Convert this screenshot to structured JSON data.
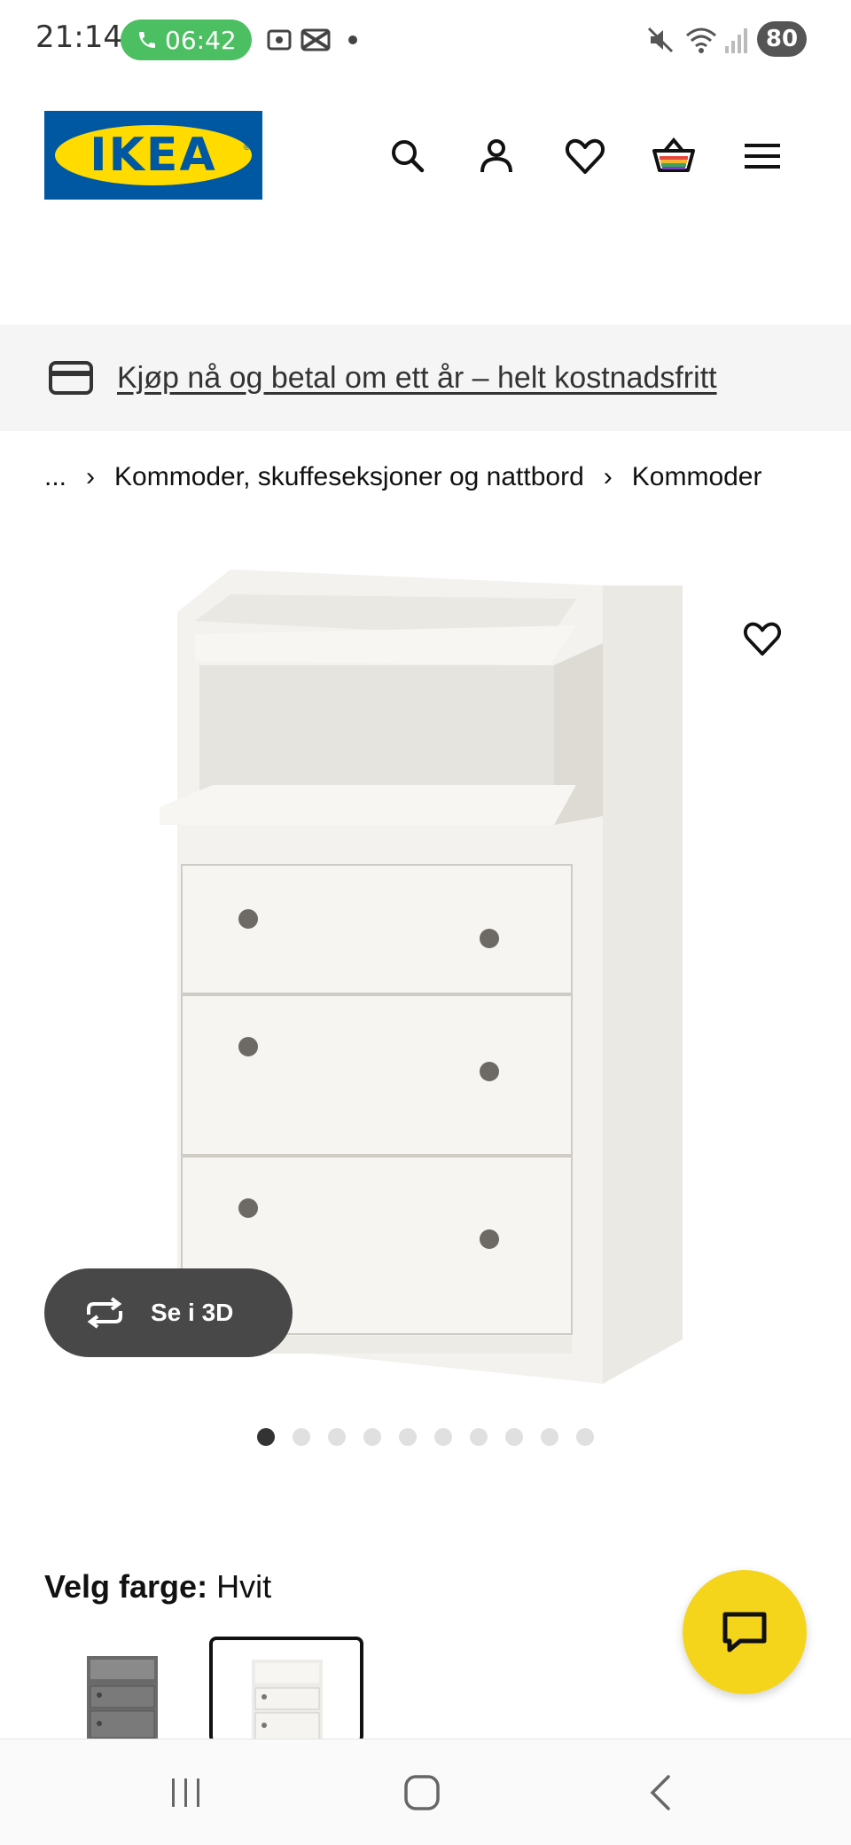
{
  "status_bar": {
    "time": "21:14",
    "call_timer": "06:42",
    "battery": "80"
  },
  "header": {
    "logo_text": "IKEA",
    "icons": [
      "search-icon",
      "account-icon",
      "wishlist-icon",
      "cart-icon",
      "menu-icon"
    ]
  },
  "promo": {
    "text": "Kjøp nå og betal om ett år – helt kostnadsfritt",
    "icon": "credit-card-icon"
  },
  "breadcrumb": {
    "ellipsis": "...",
    "items": [
      "Kommoder, skuffeseksjoner og nattbord",
      "Kommoder"
    ]
  },
  "product": {
    "view_3d_label": "Se i 3D",
    "carousel": {
      "total": 10,
      "active": 1
    }
  },
  "color": {
    "label": "Velg farge:",
    "value": "Hvit",
    "options": [
      "grey",
      "white"
    ],
    "selected_index": 1
  },
  "colors": {
    "ikea_blue": "#0058a3",
    "ikea_yellow": "#ffdb00",
    "call_green": "#4cbf63",
    "chat_yellow": "#f5d51c"
  }
}
